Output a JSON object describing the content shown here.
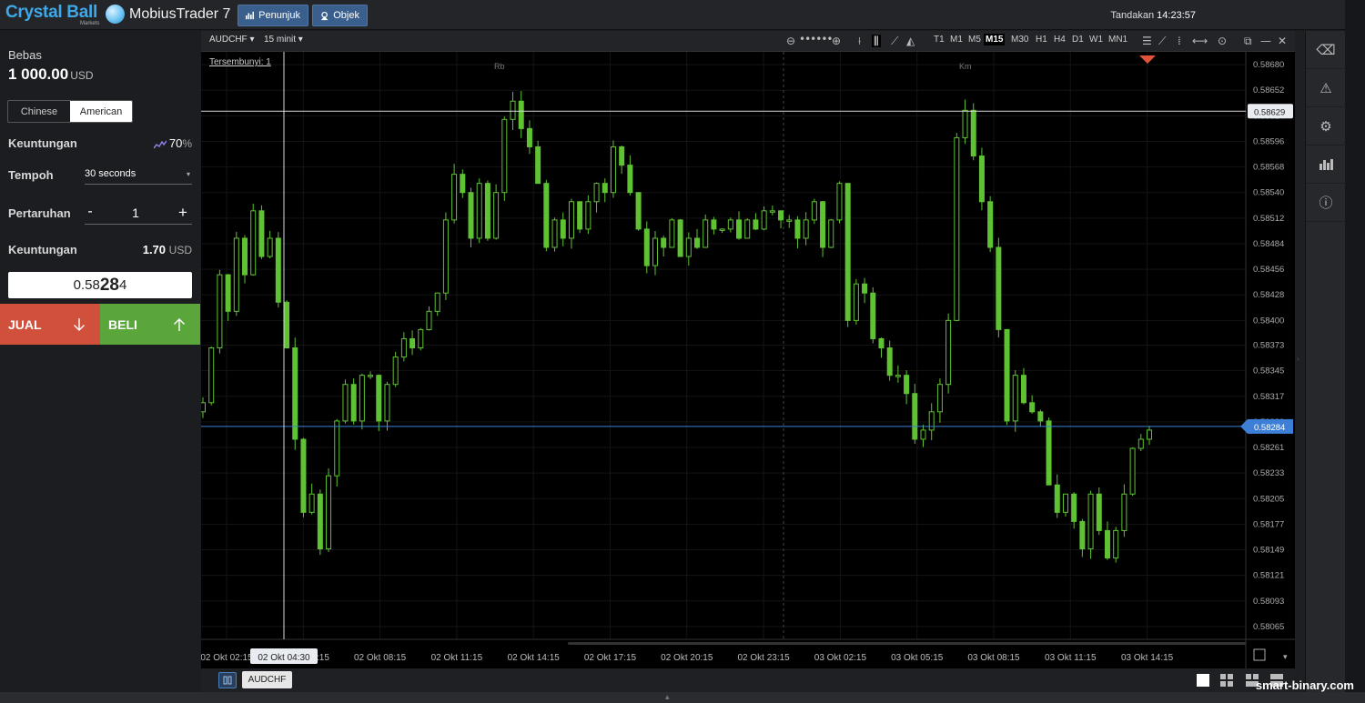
{
  "topbar": {
    "logo_text": "Crystal Ball",
    "logo_subtext": "Markets",
    "app_title": "MobiusTrader 7",
    "indicators_label": "Penunjuk",
    "objects_label": "Objek",
    "clock_label": "Tandakan",
    "clock_time": "14:23:57"
  },
  "left_panel": {
    "free_label": "Bebas",
    "balance": "1 000.00",
    "balance_currency": "USD",
    "option_types": [
      "Chinese",
      "American"
    ],
    "selected_option_type": "American",
    "profit_label": "Keuntungan",
    "profit_percent": "70",
    "profit_percent_sign": "%",
    "period_label": "Tempoh",
    "period_value": "30 seconds",
    "stake_label": "Pertaruhan",
    "stake_minus": "-",
    "stake_value": "1",
    "stake_plus": "+",
    "payout_label": "Keuntungan",
    "payout_value": "1.70",
    "payout_currency": "USD",
    "quote_prefix": "0.58",
    "quote_big": "28",
    "quote_suffix": "4",
    "sell_label": "JUAL",
    "buy_label": "BELI",
    "sell_color": "#d0503c",
    "buy_color": "#5aa63a"
  },
  "chart_toolbar": {
    "symbol": "AUDCHF",
    "timeframe": "15 minit",
    "timeframes": [
      "T1",
      "M1",
      "M5",
      "M15",
      "M30",
      "H1",
      "H4",
      "D1",
      "W1",
      "MN1"
    ],
    "active_timeframe": "M15"
  },
  "chart_data": {
    "type": "candlestick",
    "symbol": "AUDCHF",
    "hidden_label": "Tersembunyi: 1",
    "session_labels": [
      "Rb",
      "Km"
    ],
    "y_ticks": [
      "0.58680",
      "0.58652",
      "0.58624",
      "0.58596",
      "0.58568",
      "0.58540",
      "0.58512",
      "0.58484",
      "0.58456",
      "0.58428",
      "0.58400",
      "0.58373",
      "0.58345",
      "0.58317",
      "0.58289",
      "0.58261",
      "0.58233",
      "0.58205",
      "0.58177",
      "0.58149",
      "0.58121",
      "0.58093",
      "0.58065"
    ],
    "x_ticks": [
      "02 Okt 02:15",
      "02 Okt 05:15",
      "02 Okt 08:15",
      "02 Okt 11:15",
      "02 Okt 14:15",
      "02 Okt 17:15",
      "02 Okt 20:15",
      "02 Okt 23:15",
      "03 Okt 02:15",
      "03 Okt 05:15",
      "03 Okt 08:15",
      "03 Okt 11:15",
      "03 Okt 14:15"
    ],
    "crosshair_time": "02 Okt 04:30",
    "crosshair_price": "0.58629",
    "current_price": "0.58284",
    "ylim": [
      0.58051,
      0.58694
    ],
    "candle_color": "#5fc232",
    "crosshair_label_color": "#e9edf2",
    "price_tag_color": "#3d7fd6",
    "close_series": [
      0.5831,
      0.5837,
      0.5845,
      0.5841,
      0.5849,
      0.5845,
      0.5852,
      0.5847,
      0.5849,
      0.5842,
      0.5837,
      0.5827,
      0.5819,
      0.5821,
      0.5815,
      0.5823,
      0.5829,
      0.5833,
      0.5829,
      0.5834,
      0.5834,
      0.5829,
      0.5833,
      0.5836,
      0.5838,
      0.5837,
      0.5839,
      0.5841,
      0.5843,
      0.5851,
      0.5856,
      0.5854,
      0.5849,
      0.5855,
      0.5849,
      0.5854,
      0.5862,
      0.5864,
      0.5861,
      0.5859,
      0.5855,
      0.5848,
      0.5851,
      0.5849,
      0.5853,
      0.585,
      0.5853,
      0.5855,
      0.5854,
      0.5859,
      0.5857,
      0.5854,
      0.585,
      0.5846,
      0.5849,
      0.5848,
      0.5851,
      0.5847,
      0.5849,
      0.5848,
      0.5851,
      0.585,
      0.585,
      0.5851,
      0.5849,
      0.5851,
      0.585,
      0.5852,
      0.5852,
      0.5851,
      0.5851,
      0.5849,
      0.5851,
      0.5853,
      0.5848,
      0.5851,
      0.5855,
      0.584,
      0.5844,
      0.5843,
      0.5838,
      0.5837,
      0.5834,
      0.5834,
      0.5832,
      0.5827,
      0.5828,
      0.583,
      0.5833,
      0.584,
      0.586,
      0.5863,
      0.5858,
      0.5853,
      0.5848,
      0.5839,
      0.5829,
      0.5834,
      0.5831,
      0.583,
      0.5829,
      0.5822,
      0.5819,
      0.5821,
      0.5818,
      0.5815,
      0.5821,
      0.5817,
      0.5814,
      0.5817,
      0.5821,
      0.5826,
      0.5827,
      0.5828
    ]
  },
  "bottombar": {
    "symbol_tab": "AUDCHF"
  },
  "watermark": "smart-binary.com",
  "icons": {
    "indicators": "bar-chart-icon",
    "objects": "objects-icon",
    "sidebar": [
      "eraser-icon",
      "warning-icon",
      "gear-icon",
      "chart-bars-icon",
      "info-icon"
    ]
  }
}
